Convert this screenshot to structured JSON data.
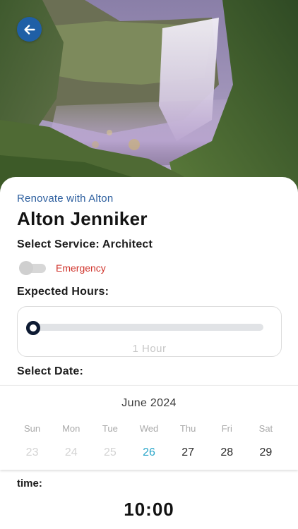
{
  "hero": {
    "image": "waterfall-photo"
  },
  "header": {
    "back_icon": "arrow-left-icon"
  },
  "provider": {
    "eyebrow": "Renovate with Alton",
    "name": "Alton Jenniker"
  },
  "service": {
    "label": "Select Service: Architect"
  },
  "emergency": {
    "label": "Emergency",
    "enabled": false,
    "color": "#d0342c"
  },
  "hours": {
    "label": "Expected Hours:",
    "value_text": "1 Hour",
    "slider_fraction": 0
  },
  "date": {
    "label": "Select Date:",
    "month": "June 2024",
    "weekdays": [
      "Sun",
      "Mon",
      "Tue",
      "Wed",
      "Thu",
      "Fri",
      "Sat"
    ],
    "days": [
      {
        "day": "23",
        "state": "past"
      },
      {
        "day": "24",
        "state": "past"
      },
      {
        "day": "25",
        "state": "past"
      },
      {
        "day": "26",
        "state": "today"
      },
      {
        "day": "27",
        "state": "normal"
      },
      {
        "day": "28",
        "state": "normal"
      },
      {
        "day": "29",
        "state": "normal"
      }
    ]
  },
  "time": {
    "label": "time:",
    "value": "10:00"
  },
  "colors": {
    "accent": "#1f5fa6",
    "today": "#2aa6c9",
    "dark": "#0e1b33"
  }
}
